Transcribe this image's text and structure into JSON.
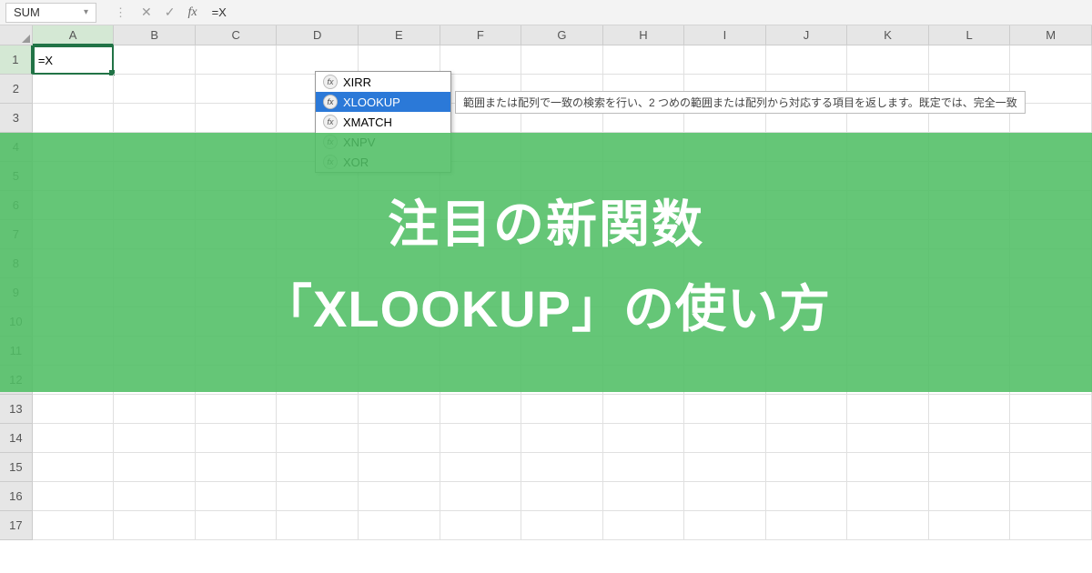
{
  "nameBox": {
    "value": "SUM"
  },
  "formulaBar": {
    "value": "=X"
  },
  "columns": [
    "A",
    "B",
    "C",
    "D",
    "E",
    "F",
    "G",
    "H",
    "I",
    "J",
    "K",
    "L",
    "M"
  ],
  "rows": [
    "1",
    "2",
    "3",
    "4",
    "5",
    "6",
    "7",
    "8",
    "9",
    "10",
    "11",
    "12",
    "13",
    "14",
    "15",
    "16",
    "17"
  ],
  "activeCell": {
    "value": "=X"
  },
  "autocomplete": {
    "items": [
      {
        "label": "XIRR",
        "selected": false
      },
      {
        "label": "XLOOKUP",
        "selected": true
      },
      {
        "label": "XMATCH",
        "selected": false
      },
      {
        "label": "XNPV",
        "selected": false
      },
      {
        "label": "XOR",
        "selected": false
      }
    ]
  },
  "tooltip": {
    "text": "範囲または配列で一致の検索を行い、2 つめの範囲または配列から対応する項目を返します。既定では、完全一致"
  },
  "banner": {
    "line1": "注目の新関数",
    "line2": "「XLOOKUP」の使い方"
  },
  "icons": {
    "fx": "fx",
    "chev": "▾",
    "dots": "⋮",
    "cancel": "✕",
    "accept": "✓"
  }
}
